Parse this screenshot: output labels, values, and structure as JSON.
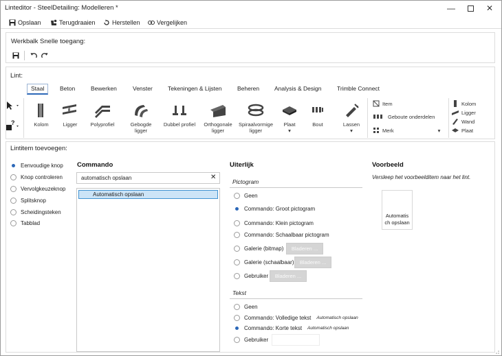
{
  "window": {
    "title": "Linteditor - SteelDetailing: Modelleren *"
  },
  "toolbar": {
    "save": "Opslaan",
    "revert": "Terugdraaien",
    "restore": "Herstellen",
    "compare": "Vergelijken"
  },
  "quick_access": {
    "label": "Werkbalk Snelle toegang:"
  },
  "ribbon": {
    "label": "Lint:",
    "tabs": [
      "Staal",
      "Beton",
      "Bewerken",
      "Venster",
      "Tekeningen & Lijsten",
      "Beheren",
      "Analysis & Design",
      "Trimble Connect"
    ],
    "buttons": {
      "kolom": "Kolom",
      "ligger": "Ligger",
      "polyprofiel": "Polyprofiel",
      "gebogen_1": "Gebogde",
      "gebogen_2": "ligger",
      "dubbel": "Dubbel profiel",
      "ortho_1": "Orthogonale",
      "ortho_2": "ligger",
      "spiraal_1": "Spiraalvormige",
      "spiraal_2": "ligger",
      "plaat": "Plaat",
      "bout": "Bout",
      "lassen": "Lassen"
    },
    "small": {
      "item": "Item",
      "gebouwde": "Geboute onderdelen",
      "merk": "Merk",
      "kolom": "Kolom",
      "ligger": "Ligger",
      "wand": "Wand",
      "plaat": "Plaat"
    }
  },
  "add_item": {
    "label": "Lintitem toevoegen:",
    "types": [
      "Eenvoudige knop",
      "Knop controleren",
      "Vervolgkeuzeknop",
      "Splitsknop",
      "Scheidingsteken",
      "Tabblad"
    ],
    "selected_type": "Eenvoudige knop"
  },
  "command": {
    "header": "Commando",
    "search_value": "automatisch opslaan",
    "results": [
      "Automatisch opslaan"
    ]
  },
  "appearance": {
    "header": "Uiterlijk",
    "pictogram_header": "Pictogram",
    "pictogram_options": [
      "Geen",
      "Commando: Groot pictogram",
      "Commando: Klein pictogram",
      "Commando: Schaalbaar pictogram",
      "Galerie (bitmap)",
      "Galerie (schaalbaar)",
      "Gebruiker"
    ],
    "pictogram_selected": "Commando: Groot pictogram",
    "browse_label": "Bladeren ...",
    "text_header": "Tekst",
    "text_options": [
      "Geen",
      "Commando: Volledige tekst",
      "Commando: Korte tekst",
      "Gebruiker"
    ],
    "text_selected": "Commando: Korte tekst",
    "full_text_hint": "Automatisch opslaan",
    "short_text_hint": "Automatisch opslaan"
  },
  "preview": {
    "header": "Voorbeeld",
    "hint": "Versleep het voorbeelditem naar het lint.",
    "item_line1": "Automatis",
    "item_line2": "ch opslaan"
  },
  "colors": {
    "accent": "#2b67b8",
    "selection": "#cce4f7",
    "disabled": "#d5d5d5"
  }
}
